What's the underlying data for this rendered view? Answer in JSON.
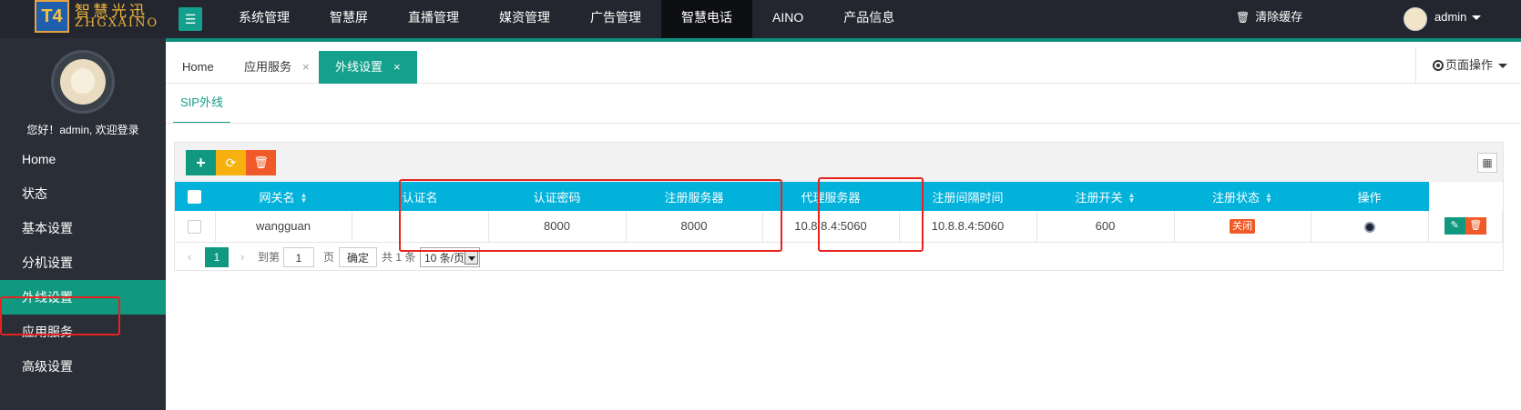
{
  "brand": {
    "badge": "T4",
    "name_cn": "智慧光迅",
    "name_en": "ZHGXAINO"
  },
  "topnav": {
    "items": [
      "系统管理",
      "智慧屏",
      "直播管理",
      "媒资管理",
      "广告管理",
      "智慧电话",
      "AINO",
      "产品信息"
    ],
    "active": "智慧电话",
    "clear_cache": "清除缓存",
    "user": "admin"
  },
  "sidebar": {
    "welcome": "您好！admin, 欢迎登录",
    "items": [
      "Home",
      "状态",
      "基本设置",
      "分机设置",
      "外线设置",
      "应用服务",
      "高级设置"
    ],
    "active": "外线设置"
  },
  "tabs": {
    "items": [
      {
        "label": "Home",
        "closable": false
      },
      {
        "label": "应用服务",
        "closable": true
      },
      {
        "label": "外线设置",
        "closable": true
      }
    ],
    "close_glyph": "×",
    "page_ops": "页面操作"
  },
  "subtab": {
    "label": "SIP外线"
  },
  "toolbar": {
    "add": "+",
    "refresh": "⟳",
    "delete": "🗑",
    "columns": "▦"
  },
  "table": {
    "columns": [
      "网关名",
      "认证名",
      "认证密码",
      "注册服务器",
      "代理服务器",
      "注册间隔时间",
      "注册开关",
      "注册状态",
      "操作"
    ],
    "rows": [
      {
        "gateway": "wangguan",
        "auth_name": "8000",
        "auth_password": "8000",
        "reg_server": "10.8.8.4:5060",
        "proxy_server": "10.8.8.4:5060",
        "interval": "600",
        "switch": "关闭",
        "status": "offline"
      }
    ]
  },
  "pager": {
    "current": "1",
    "goto_label": "到第",
    "page_input": "1",
    "page_unit": "页",
    "confirm": "确定",
    "total": "共 1 条",
    "page_size": "10 条/页"
  },
  "colors": {
    "accent": "#109980",
    "header": "#02b2db",
    "danger": "#f05a28",
    "warn": "#f6b10f",
    "topbar": "#23262e",
    "sidebar": "#2a2e36"
  }
}
